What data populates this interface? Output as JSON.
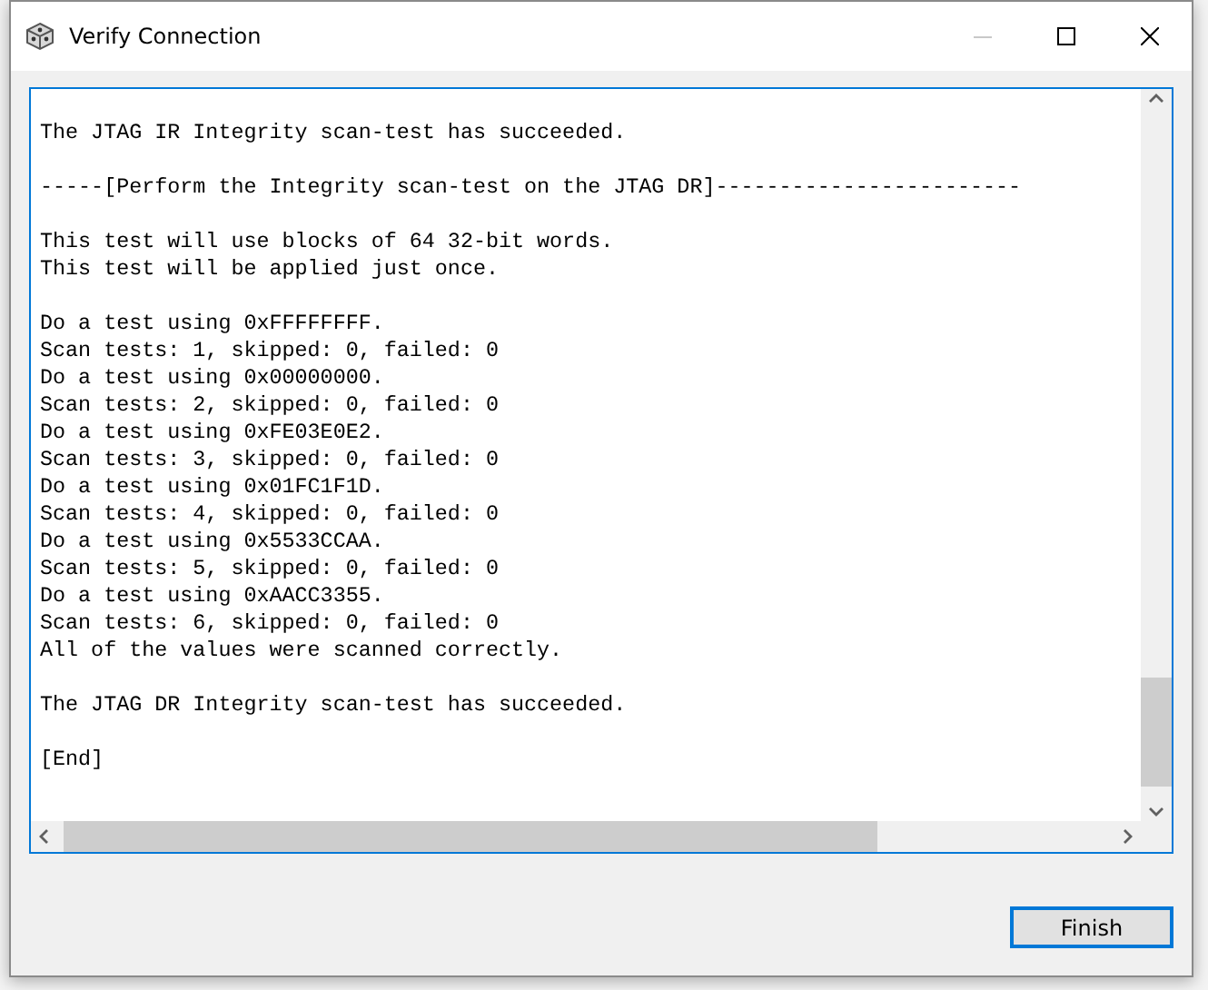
{
  "window": {
    "title": "Verify Connection"
  },
  "log": {
    "blocks": [
      [
        "The JTAG IR Integrity scan-test has succeeded."
      ],
      [
        "-----[Perform the Integrity scan-test on the JTAG DR]------------------------"
      ],
      [
        "This test will use blocks of 64 32-bit words.",
        "This test will be applied just once."
      ],
      [
        "Do a test using 0xFFFFFFFF.",
        "Scan tests: 1, skipped: 0, failed: 0",
        "Do a test using 0x00000000.",
        "Scan tests: 2, skipped: 0, failed: 0",
        "Do a test using 0xFE03E0E2.",
        "Scan tests: 3, skipped: 0, failed: 0",
        "Do a test using 0x01FC1F1D.",
        "Scan tests: 4, skipped: 0, failed: 0",
        "Do a test using 0x5533CCAA.",
        "Scan tests: 5, skipped: 0, failed: 0",
        "Do a test using 0xAACC3355.",
        "Scan tests: 6, skipped: 0, failed: 0",
        "All of the values were scanned correctly."
      ],
      [
        "The JTAG DR Integrity scan-test has succeeded."
      ],
      [
        "[End]"
      ]
    ]
  },
  "buttons": [
    {
      "label": "Finish",
      "default": true
    }
  ]
}
